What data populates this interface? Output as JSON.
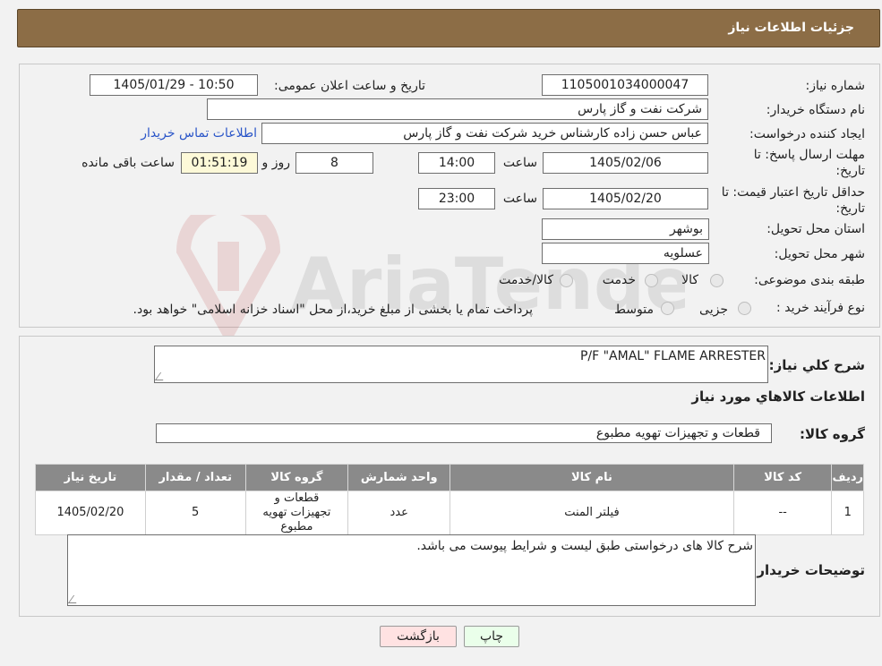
{
  "header": {
    "title": "جزئیات اطلاعات نیاز"
  },
  "form": {
    "need_number_label": "شماره نیاز:",
    "need_number": "1105001034000047",
    "announce_label": "تاریخ و ساعت اعلان عمومی:",
    "announce_value": "1405/01/29 - 10:50",
    "buyer_org_label": "نام دستگاه خریدار:",
    "buyer_org": "شرکت نفت و گاز پارس",
    "requester_label": "ایجاد کننده درخواست:",
    "requester": "عباس حسن زاده کارشناس خرید شرکت نفت و گاز پارس",
    "contact_link": "اطلاعات تماس خریدار",
    "deadline_label_1": "مهلت ارسال پاسخ: تا",
    "deadline_label_2": "تاریخ:",
    "deadline_date": "1405/02/06",
    "time_label": "ساعت",
    "deadline_time": "14:00",
    "days_value": "8",
    "days_label": "روز و",
    "remaining_time": "01:51:19",
    "remaining_label": "ساعت باقی مانده",
    "validity_label_1": "حداقل تاریخ اعتبار قیمت: تا",
    "validity_label_2": "تاریخ:",
    "validity_date": "1405/02/20",
    "validity_time_label": "ساعت",
    "validity_time": "23:00",
    "province_label": "استان محل تحویل:",
    "province": "بوشهر",
    "city_label": "شهر محل تحویل:",
    "city": "عسلویه",
    "category_label": "طبقه بندی موضوعی:",
    "category_options": [
      "کالا",
      "خدمت",
      "کالا/خدمت"
    ],
    "process_label": "نوع فرآیند خرید :",
    "process_options": [
      "جزیی",
      "متوسط"
    ],
    "process_note": "پرداخت تمام یا بخشی از مبلغ خرید،از محل \"اسناد خزانه اسلامی\" خواهد بود."
  },
  "details": {
    "summary_label": "شرح کلي نیاز:",
    "summary": "P/F \"AMAL\" FLAME ARRESTER",
    "items_heading": "اطلاعات کالاهاي مورد نیاز",
    "group_label": "گروه کالا:",
    "group_value": "قطعات و تجهیزات تهویه مطبوع",
    "table_headers": [
      "ردیف",
      "کد کالا",
      "نام کالا",
      "واحد شمارش",
      "گروه کالا",
      "تعداد / مقدار",
      "تاریخ نیاز"
    ],
    "rows": [
      {
        "row": "1",
        "code": "--",
        "name": "فیلتر المنت",
        "unit": "عدد",
        "group": "قطعات و تجهیزات تهویه مطبوع",
        "qty": "5",
        "date": "1405/02/20"
      }
    ],
    "buyer_notes_label": "توضیحات خریدار:",
    "buyer_notes": "شرح کالا های درخواستی طبق لیست و شرایط پیوست می باشد."
  },
  "buttons": {
    "print": "چاپ",
    "back": "بازگشت"
  },
  "watermark": {
    "text": "AriaTender.neT"
  }
}
